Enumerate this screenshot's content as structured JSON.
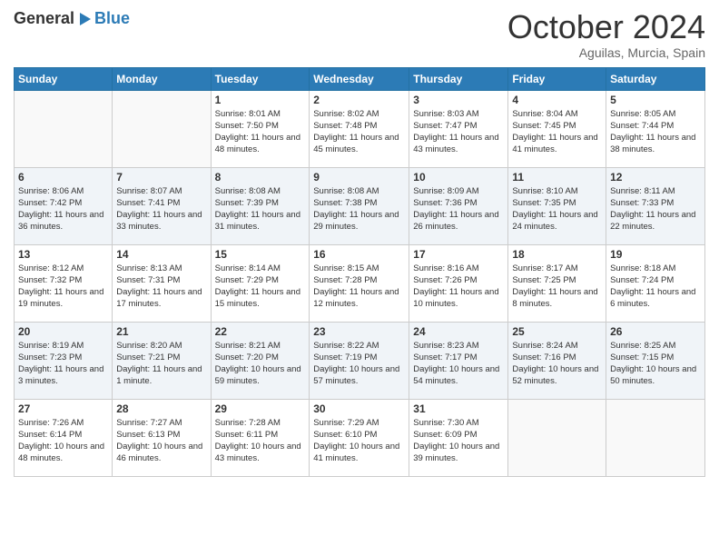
{
  "logo": {
    "general": "General",
    "blue": "Blue"
  },
  "title": "October 2024",
  "location": "Aguilas, Murcia, Spain",
  "headers": [
    "Sunday",
    "Monday",
    "Tuesday",
    "Wednesday",
    "Thursday",
    "Friday",
    "Saturday"
  ],
  "weeks": [
    [
      {
        "day": "",
        "sunrise": "",
        "sunset": "",
        "daylight": ""
      },
      {
        "day": "",
        "sunrise": "",
        "sunset": "",
        "daylight": ""
      },
      {
        "day": "1",
        "sunrise": "Sunrise: 8:01 AM",
        "sunset": "Sunset: 7:50 PM",
        "daylight": "Daylight: 11 hours and 48 minutes."
      },
      {
        "day": "2",
        "sunrise": "Sunrise: 8:02 AM",
        "sunset": "Sunset: 7:48 PM",
        "daylight": "Daylight: 11 hours and 45 minutes."
      },
      {
        "day": "3",
        "sunrise": "Sunrise: 8:03 AM",
        "sunset": "Sunset: 7:47 PM",
        "daylight": "Daylight: 11 hours and 43 minutes."
      },
      {
        "day": "4",
        "sunrise": "Sunrise: 8:04 AM",
        "sunset": "Sunset: 7:45 PM",
        "daylight": "Daylight: 11 hours and 41 minutes."
      },
      {
        "day": "5",
        "sunrise": "Sunrise: 8:05 AM",
        "sunset": "Sunset: 7:44 PM",
        "daylight": "Daylight: 11 hours and 38 minutes."
      }
    ],
    [
      {
        "day": "6",
        "sunrise": "Sunrise: 8:06 AM",
        "sunset": "Sunset: 7:42 PM",
        "daylight": "Daylight: 11 hours and 36 minutes."
      },
      {
        "day": "7",
        "sunrise": "Sunrise: 8:07 AM",
        "sunset": "Sunset: 7:41 PM",
        "daylight": "Daylight: 11 hours and 33 minutes."
      },
      {
        "day": "8",
        "sunrise": "Sunrise: 8:08 AM",
        "sunset": "Sunset: 7:39 PM",
        "daylight": "Daylight: 11 hours and 31 minutes."
      },
      {
        "day": "9",
        "sunrise": "Sunrise: 8:08 AM",
        "sunset": "Sunset: 7:38 PM",
        "daylight": "Daylight: 11 hours and 29 minutes."
      },
      {
        "day": "10",
        "sunrise": "Sunrise: 8:09 AM",
        "sunset": "Sunset: 7:36 PM",
        "daylight": "Daylight: 11 hours and 26 minutes."
      },
      {
        "day": "11",
        "sunrise": "Sunrise: 8:10 AM",
        "sunset": "Sunset: 7:35 PM",
        "daylight": "Daylight: 11 hours and 24 minutes."
      },
      {
        "day": "12",
        "sunrise": "Sunrise: 8:11 AM",
        "sunset": "Sunset: 7:33 PM",
        "daylight": "Daylight: 11 hours and 22 minutes."
      }
    ],
    [
      {
        "day": "13",
        "sunrise": "Sunrise: 8:12 AM",
        "sunset": "Sunset: 7:32 PM",
        "daylight": "Daylight: 11 hours and 19 minutes."
      },
      {
        "day": "14",
        "sunrise": "Sunrise: 8:13 AM",
        "sunset": "Sunset: 7:31 PM",
        "daylight": "Daylight: 11 hours and 17 minutes."
      },
      {
        "day": "15",
        "sunrise": "Sunrise: 8:14 AM",
        "sunset": "Sunset: 7:29 PM",
        "daylight": "Daylight: 11 hours and 15 minutes."
      },
      {
        "day": "16",
        "sunrise": "Sunrise: 8:15 AM",
        "sunset": "Sunset: 7:28 PM",
        "daylight": "Daylight: 11 hours and 12 minutes."
      },
      {
        "day": "17",
        "sunrise": "Sunrise: 8:16 AM",
        "sunset": "Sunset: 7:26 PM",
        "daylight": "Daylight: 11 hours and 10 minutes."
      },
      {
        "day": "18",
        "sunrise": "Sunrise: 8:17 AM",
        "sunset": "Sunset: 7:25 PM",
        "daylight": "Daylight: 11 hours and 8 minutes."
      },
      {
        "day": "19",
        "sunrise": "Sunrise: 8:18 AM",
        "sunset": "Sunset: 7:24 PM",
        "daylight": "Daylight: 11 hours and 6 minutes."
      }
    ],
    [
      {
        "day": "20",
        "sunrise": "Sunrise: 8:19 AM",
        "sunset": "Sunset: 7:23 PM",
        "daylight": "Daylight: 11 hours and 3 minutes."
      },
      {
        "day": "21",
        "sunrise": "Sunrise: 8:20 AM",
        "sunset": "Sunset: 7:21 PM",
        "daylight": "Daylight: 11 hours and 1 minute."
      },
      {
        "day": "22",
        "sunrise": "Sunrise: 8:21 AM",
        "sunset": "Sunset: 7:20 PM",
        "daylight": "Daylight: 10 hours and 59 minutes."
      },
      {
        "day": "23",
        "sunrise": "Sunrise: 8:22 AM",
        "sunset": "Sunset: 7:19 PM",
        "daylight": "Daylight: 10 hours and 57 minutes."
      },
      {
        "day": "24",
        "sunrise": "Sunrise: 8:23 AM",
        "sunset": "Sunset: 7:17 PM",
        "daylight": "Daylight: 10 hours and 54 minutes."
      },
      {
        "day": "25",
        "sunrise": "Sunrise: 8:24 AM",
        "sunset": "Sunset: 7:16 PM",
        "daylight": "Daylight: 10 hours and 52 minutes."
      },
      {
        "day": "26",
        "sunrise": "Sunrise: 8:25 AM",
        "sunset": "Sunset: 7:15 PM",
        "daylight": "Daylight: 10 hours and 50 minutes."
      }
    ],
    [
      {
        "day": "27",
        "sunrise": "Sunrise: 7:26 AM",
        "sunset": "Sunset: 6:14 PM",
        "daylight": "Daylight: 10 hours and 48 minutes."
      },
      {
        "day": "28",
        "sunrise": "Sunrise: 7:27 AM",
        "sunset": "Sunset: 6:13 PM",
        "daylight": "Daylight: 10 hours and 46 minutes."
      },
      {
        "day": "29",
        "sunrise": "Sunrise: 7:28 AM",
        "sunset": "Sunset: 6:11 PM",
        "daylight": "Daylight: 10 hours and 43 minutes."
      },
      {
        "day": "30",
        "sunrise": "Sunrise: 7:29 AM",
        "sunset": "Sunset: 6:10 PM",
        "daylight": "Daylight: 10 hours and 41 minutes."
      },
      {
        "day": "31",
        "sunrise": "Sunrise: 7:30 AM",
        "sunset": "Sunset: 6:09 PM",
        "daylight": "Daylight: 10 hours and 39 minutes."
      },
      {
        "day": "",
        "sunrise": "",
        "sunset": "",
        "daylight": ""
      },
      {
        "day": "",
        "sunrise": "",
        "sunset": "",
        "daylight": ""
      }
    ]
  ]
}
